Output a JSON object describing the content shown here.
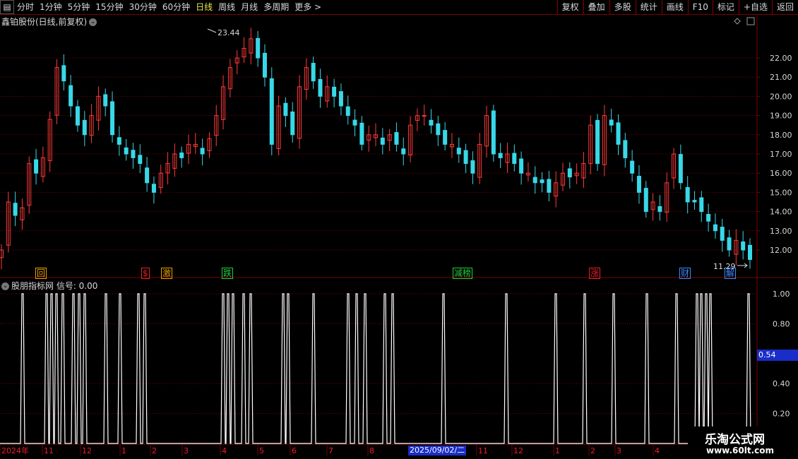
{
  "toolbar": {
    "periods": [
      "分时",
      "1分钟",
      "5分钟",
      "15分钟",
      "30分钟",
      "60分钟",
      "日线",
      "周线",
      "月线",
      "多周期",
      "更多 >"
    ],
    "active_period": "日线",
    "menu_icon": "menu-icon",
    "right_buttons": [
      "复权",
      "叠加",
      "多股",
      "统计",
      "画线",
      "F10",
      "标记",
      "+自选",
      "返回"
    ]
  },
  "main_chart": {
    "title": "鑫铂股份(日线,前复权)",
    "y_axis_labels": [
      "22.00",
      "21.00",
      "20.00",
      "19.00",
      "18.00",
      "17.00",
      "16.00",
      "15.00",
      "14.00",
      "13.00",
      "12.00"
    ],
    "high_label": "23.44",
    "low_label": "11.29",
    "event_tags": [
      {
        "text": "回",
        "color": "#e8a000"
      },
      {
        "text": "$",
        "color": "#e8202a"
      },
      {
        "text": "激",
        "color": "#e8a000"
      },
      {
        "text": "跌",
        "color": "#20d040"
      },
      {
        "text": "减榜",
        "color": "#20d040"
      },
      {
        "text": "涨",
        "color": "#e8202a"
      },
      {
        "text": "财",
        "color": "#3a8cff"
      },
      {
        "text": "解",
        "color": "#3a8cff"
      }
    ],
    "colors": {
      "up": "#ff3a3a",
      "down": "#38d8e8",
      "grid": "#7a0000"
    }
  },
  "indicator": {
    "title": "股朋指标网 信号: 0.00",
    "y_axis_labels": [
      "1.00",
      "0.80",
      "0.54",
      "0.40",
      "0.20"
    ],
    "current_value": "0.54"
  },
  "x_axis": {
    "labels": [
      "2024年",
      "11",
      "12",
      "1",
      "2",
      "3",
      "4",
      "5",
      "6",
      "7",
      "8",
      "2025/09/02/二",
      "11",
      "12",
      "1",
      "2",
      "3",
      "4"
    ]
  },
  "watermark": {
    "line1": "乐淘公式网",
    "line2": "www.60lt.com"
  },
  "chart_data": {
    "type": "candlestick",
    "title": "鑫铂股份(日线,前复权)",
    "y_range": [
      11.29,
      23.44
    ],
    "annotated_high": 23.44,
    "annotated_low": 11.29,
    "closes_approx": [
      12.0,
      14.5,
      13.8,
      14.2,
      16.5,
      16.0,
      16.8,
      18.8,
      21.5,
      20.8,
      19.5,
      18.5,
      18.0,
      19.0,
      20.0,
      19.5,
      18.0,
      17.5,
      17.0,
      16.8,
      16.5,
      15.5,
      15.0,
      16.0,
      16.5,
      17.0,
      16.8,
      17.5,
      17.5,
      17.0,
      17.8,
      19.0,
      20.5,
      21.5,
      22.0,
      22.5,
      23.0,
      22.0,
      21.0,
      17.5,
      19.5,
      19.0,
      18.0,
      20.5,
      21.5,
      20.8,
      20.0,
      20.5,
      20.0,
      19.5,
      19.0,
      18.5,
      17.5,
      18.0,
      18.0,
      17.5,
      18.0,
      17.5,
      17.0,
      18.5,
      19.0,
      19.0,
      18.5,
      18.0,
      17.5,
      17.5,
      17.0,
      16.5,
      16.0,
      17.5,
      19.0,
      17.0,
      16.8,
      17.0,
      16.5,
      16.0,
      16.0,
      15.5,
      15.5,
      15.0,
      15.5,
      16.0,
      15.8,
      16.0,
      16.5,
      18.5,
      16.5,
      19.0,
      18.5,
      17.5,
      16.8,
      16.0,
      15.0,
      14.0,
      14.5,
      14.0,
      15.5,
      17.0,
      15.5,
      14.5,
      14.5,
      14.0,
      13.5,
      13.0,
      12.5,
      12.0,
      12.5,
      12.0,
      11.5
    ],
    "indicator": {
      "name": "信号",
      "current": 0.54,
      "y_axis_ticks": [
        1.0,
        0.8,
        0.4,
        0.2
      ]
    }
  }
}
